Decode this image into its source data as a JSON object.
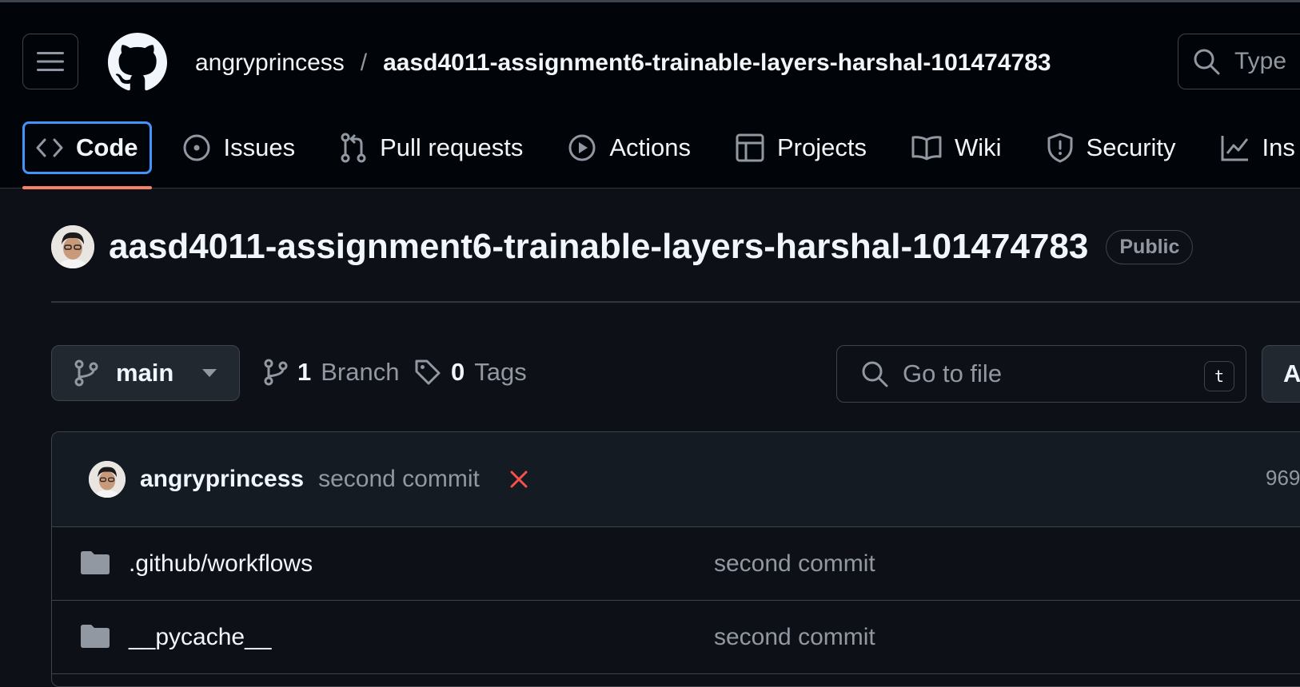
{
  "header": {
    "owner": "angryprincess",
    "separator": "/",
    "repo": "aasd4011-assignment6-trainable-layers-harshal-101474783",
    "search_placeholder": "Type"
  },
  "tabs": [
    {
      "label": "Code",
      "icon": "code-icon",
      "active": true
    },
    {
      "label": "Issues",
      "icon": "issue-opened-icon"
    },
    {
      "label": "Pull requests",
      "icon": "git-pull-request-icon"
    },
    {
      "label": "Actions",
      "icon": "play-icon"
    },
    {
      "label": "Projects",
      "icon": "table-icon"
    },
    {
      "label": "Wiki",
      "icon": "book-icon"
    },
    {
      "label": "Security",
      "icon": "shield-icon"
    },
    {
      "label": "Ins",
      "icon": "graph-icon"
    }
  ],
  "repo": {
    "name": "aasd4011-assignment6-trainable-layers-harshal-101474783",
    "visibility": "Public"
  },
  "toolbar": {
    "branch": "main",
    "branch_count": "1",
    "branch_label": "Branch",
    "tag_count": "0",
    "tag_label": "Tags",
    "goto_placeholder": "Go to file",
    "goto_shortcut": "t",
    "add_label": "A"
  },
  "latest_commit": {
    "author": "angryprincess",
    "message": "second commit",
    "status": "failed",
    "hash": "969"
  },
  "files": [
    {
      "name": ".github/workflows",
      "type": "folder",
      "commit": "second commit"
    },
    {
      "name": "__pycache__",
      "type": "folder",
      "commit": "second commit"
    }
  ],
  "colors": {
    "background": "#0d1117",
    "header": "#010409",
    "accent_blue": "#4493f8",
    "active_underline": "#f78166",
    "danger": "#f85149",
    "muted": "#9198a1"
  }
}
